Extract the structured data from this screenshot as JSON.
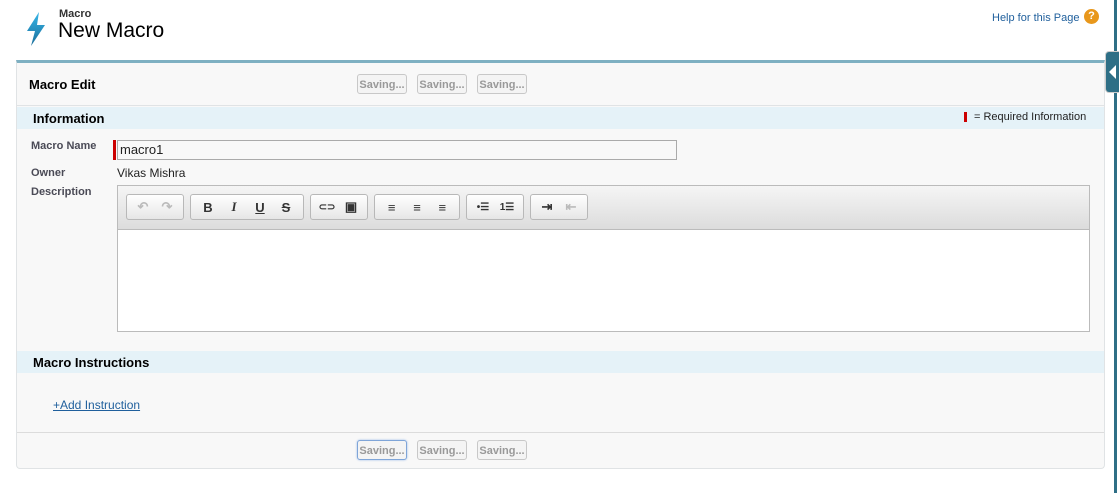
{
  "header": {
    "object_label": "Macro",
    "title": "New Macro",
    "help_link": "Help for this Page",
    "help_icon": "?"
  },
  "panel": {
    "title": "Macro Edit",
    "buttons": [
      "Saving...",
      "Saving...",
      "Saving..."
    ],
    "bottom_buttons": [
      "Saving...",
      "Saving...",
      "Saving..."
    ]
  },
  "information": {
    "title": "Information",
    "required_legend": "= Required Information",
    "fields": {
      "macro_name_label": "Macro Name",
      "macro_name_value": "macro1",
      "owner_label": "Owner",
      "owner_value": "Vikas Mishra",
      "description_label": "Description"
    }
  },
  "toolbar": {
    "undo": "↶",
    "redo": "↷",
    "bold": "B",
    "italic": "I",
    "underline": "U",
    "strike": "S",
    "link": "⊂⊃",
    "image": "▣",
    "align_left": "≡",
    "align_center": "≡",
    "align_right": "≡",
    "bullets": "•☰",
    "numbers": "1☰",
    "indent": "⇥",
    "outdent": "⇤"
  },
  "instructions": {
    "title": "Macro Instructions",
    "add_link": "+Add Instruction"
  },
  "colors": {
    "accent": "#7eb0c2",
    "band": "#e5f2f8",
    "link": "#1f5f9c",
    "required": "#cc0000"
  }
}
